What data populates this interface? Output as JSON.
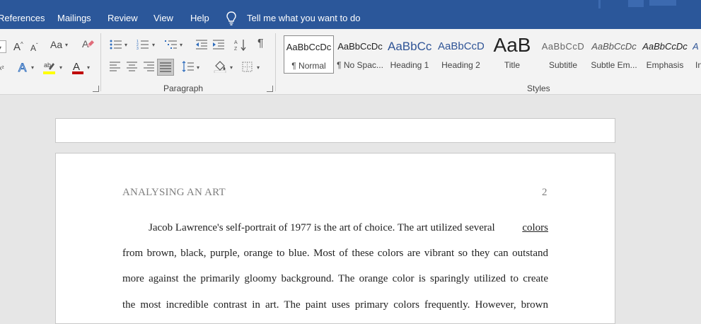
{
  "menu": {
    "tabs": [
      "References",
      "Mailings",
      "Review",
      "View",
      "Help"
    ],
    "tell_me": "Tell me what you want to do"
  },
  "ribbon": {
    "paragraph_label": "Paragraph",
    "styles_label": "Styles",
    "font_case_label": "Aa",
    "styles": [
      {
        "sample": "AaBbCcDc",
        "name": "¶ Normal"
      },
      {
        "sample": "AaBbCcDc",
        "name": "¶ No Spac..."
      },
      {
        "sample": "AaBbCc",
        "name": "Heading 1"
      },
      {
        "sample": "AaBbCcD",
        "name": "Heading 2"
      },
      {
        "sample": "AaB",
        "name": "Title"
      },
      {
        "sample": "AaBbCcD",
        "name": "Subtitle"
      },
      {
        "sample": "AaBbCcDc",
        "name": "Subtle Em..."
      },
      {
        "sample": "AaBbCcDc",
        "name": "Emphasis"
      },
      {
        "sample": "A",
        "name": "In"
      }
    ]
  },
  "document": {
    "running_head": "ANALYSING AN ART",
    "page_number": "2",
    "lines": [
      "Jacob Lawrence's self-portrait of 1977 is the art of choice. The art utilized several",
      "colors",
      "from brown, black, purple, orange to blue. Most of these colors are vibrant so they can outstand",
      "more against the primarily gloomy background. The orange color is sparingly utilized to create",
      "the most incredible contrast in art. The paint uses primary colors frequently. However, brown"
    ]
  },
  "colors": {
    "title_bar": "#2b579a",
    "ribbon_bg": "#f3f3f3",
    "canvas_bg": "#e6e6e6",
    "highlight_yellow": "#ffff00",
    "font_color_red": "#c00000"
  }
}
